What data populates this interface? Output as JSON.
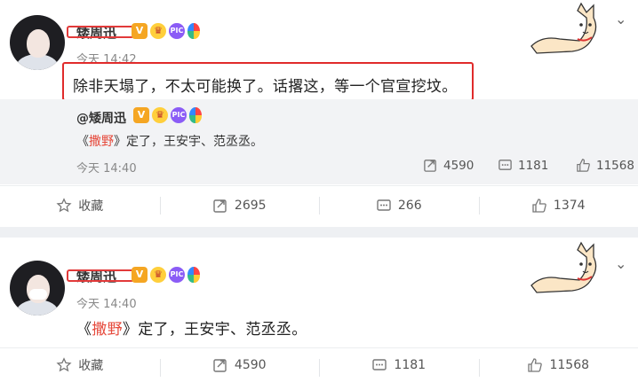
{
  "post1": {
    "username": "矮周迅",
    "time": "今天 14:42",
    "text": "除非天塌了，不太可能换了。话撂这，等一个官宣挖坟。",
    "repost": {
      "username": "@矮周迅",
      "text_prefix": "《",
      "text_highlight": "撒野",
      "text_suffix": "》定了，王安宇、范丞丞。",
      "time": "今天 14:40",
      "stats": {
        "reposts": "4590",
        "comments": "1181",
        "likes": "11568"
      }
    },
    "actions": {
      "favorite": "收藏",
      "reposts": "2695",
      "comments": "266",
      "likes": "1374"
    }
  },
  "post2": {
    "username": "矮周迅",
    "time": "今天 14:40",
    "text_prefix": "《",
    "text_highlight": "撒野",
    "text_suffix": "》定了，王安宇、范丞丞。",
    "actions": {
      "favorite": "收藏",
      "reposts": "4590",
      "comments": "1181",
      "likes": "11568"
    }
  },
  "badges": {
    "verified": "V",
    "pic": "PIC"
  },
  "icons": [
    "star-icon",
    "repost-icon",
    "comment-icon",
    "like-icon",
    "chevron-down-icon",
    "dog-sticker-icon"
  ],
  "colors": {
    "highlight": "#e6493b",
    "box": "#e02b2b",
    "repost_bg": "#f2f3f5"
  }
}
